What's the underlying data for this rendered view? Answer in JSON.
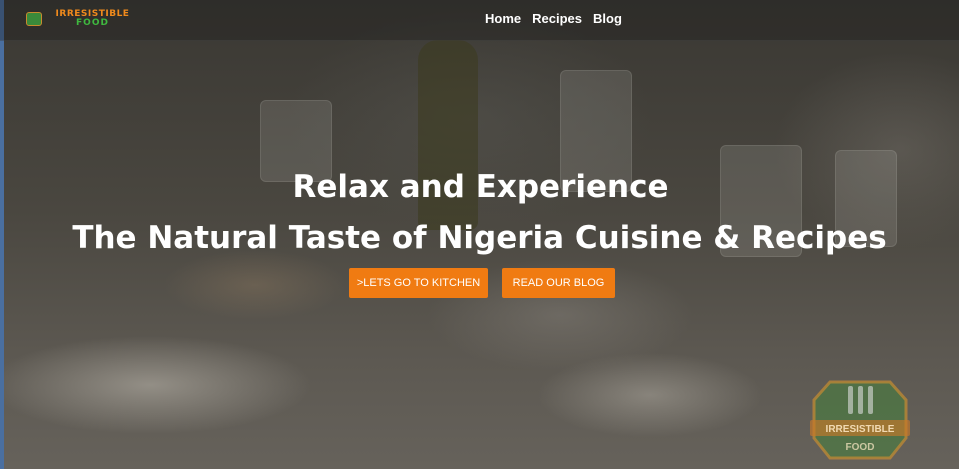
{
  "brand": {
    "line1": "IRRESISTIBLE",
    "line2": "FOOD",
    "logo_icon": "food-logo-icon",
    "colors": {
      "orange": "#f08a1c",
      "green": "#3fb83f"
    }
  },
  "nav": {
    "items": [
      {
        "label": "Home"
      },
      {
        "label": "Recipes"
      },
      {
        "label": "Blog"
      }
    ]
  },
  "hero": {
    "title_line1": "Relax and Experience",
    "title_line2": "The Natural Taste of Nigeria Cuisine & Recipes",
    "primary_button": ">LETS GO TO KITCHEN",
    "secondary_button": "READ OUR BLOG",
    "button_color": "#f07b12"
  },
  "badge": {
    "line1": "IRRESISTIBLE",
    "line2": "FOOD",
    "icon": "utensils-badge-icon"
  }
}
